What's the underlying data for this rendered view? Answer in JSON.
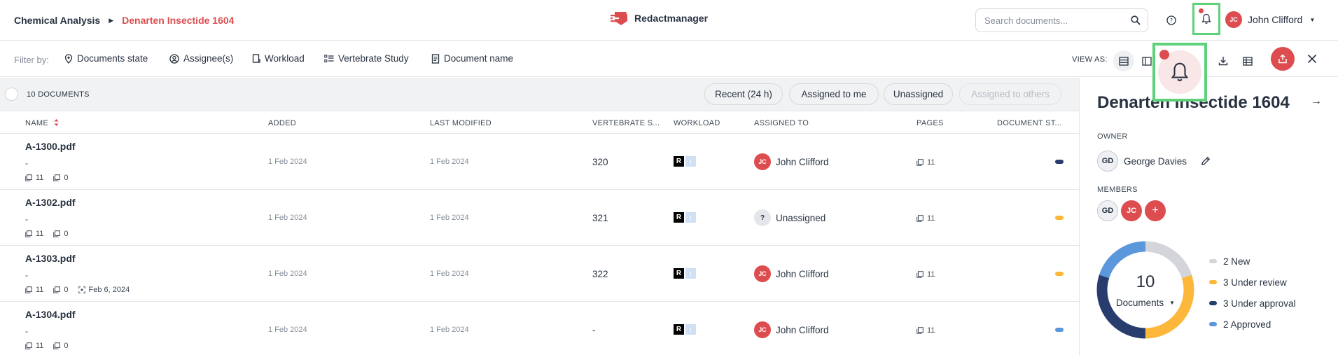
{
  "breadcrumb": {
    "parent": "Chemical Analysis",
    "current": "Denarten Insectide 1604"
  },
  "app": {
    "name": "Redactmanager"
  },
  "search": {
    "placeholder": "Search documents..."
  },
  "user": {
    "initials": "JC",
    "name": "John Clifford"
  },
  "filters": {
    "label": "Filter by:",
    "items": [
      "Documents state",
      "Assignee(s)",
      "Workload",
      "Vertebrate Study",
      "Document name"
    ]
  },
  "view_as": {
    "label": "VIEW AS:"
  },
  "table": {
    "count_label": "10 DOCUMENTS",
    "chips": [
      "Recent (24 h)",
      "Assigned to me",
      "Unassigned",
      "Assigned to others"
    ],
    "columns": [
      "NAME",
      "ADDED",
      "LAST MODIFIED",
      "VERTEBRATE S...",
      "WORKLOAD",
      "ASSIGNED TO",
      "PAGES",
      "DOCUMENT ST..."
    ],
    "rows": [
      {
        "name": "A-1300.pdf",
        "dash": "-",
        "pages_meta": "11",
        "comments": "0",
        "extra": "",
        "added": "1 Feb 2024",
        "modified": "1 Feb 2024",
        "vertebrate": "320",
        "wl_r": "R",
        "wl_i": "I",
        "assignee_initials": "JC",
        "assignee": "John Clifford",
        "pages": "11",
        "state_color": "#283c6e"
      },
      {
        "name": "A-1302.pdf",
        "dash": "-",
        "pages_meta": "11",
        "comments": "0",
        "extra": "",
        "added": "1 Feb 2024",
        "modified": "1 Feb 2024",
        "vertebrate": "321",
        "wl_r": "R",
        "wl_i": "I",
        "assignee_initials": "?",
        "assignee": "Unassigned",
        "pages": "11",
        "state_color": "#fdb73b"
      },
      {
        "name": "A-1303.pdf",
        "dash": "-",
        "pages_meta": "11",
        "comments": "0",
        "extra": "Feb 6, 2024",
        "added": "1 Feb 2024",
        "modified": "1 Feb 2024",
        "vertebrate": "322",
        "wl_r": "R",
        "wl_i": "I",
        "assignee_initials": "JC",
        "assignee": "John Clifford",
        "pages": "11",
        "state_color": "#fdb73b"
      },
      {
        "name": "A-1304.pdf",
        "dash": "-",
        "pages_meta": "11",
        "comments": "0",
        "extra": "",
        "added": "1 Feb 2024",
        "modified": "1 Feb 2024",
        "vertebrate": "-",
        "wl_r": "R",
        "wl_i": "I",
        "assignee_initials": "JC",
        "assignee": "John Clifford",
        "pages": "11",
        "state_color": "#5b97db"
      }
    ]
  },
  "panel": {
    "title": "Denarten Insectide 1604",
    "owner_label": "OWNER",
    "owner_initials": "GD",
    "owner_name": "George Davies",
    "members_label": "MEMBERS",
    "members": [
      "GD",
      "JC"
    ],
    "add_symbol": "+",
    "donut": {
      "total": "10",
      "label": "Documents",
      "segments": [
        {
          "label": "2 New",
          "value": 2,
          "color": "#d3d5da"
        },
        {
          "label": "3 Under review",
          "value": 3,
          "color": "#fdb73b"
        },
        {
          "label": "3 Under approval",
          "value": 3,
          "color": "#283c6e"
        },
        {
          "label": "2 Approved",
          "value": 2,
          "color": "#5b97db"
        }
      ]
    }
  },
  "colors": {
    "accent": "#dd4d50",
    "highlight": "#5fd17b"
  }
}
